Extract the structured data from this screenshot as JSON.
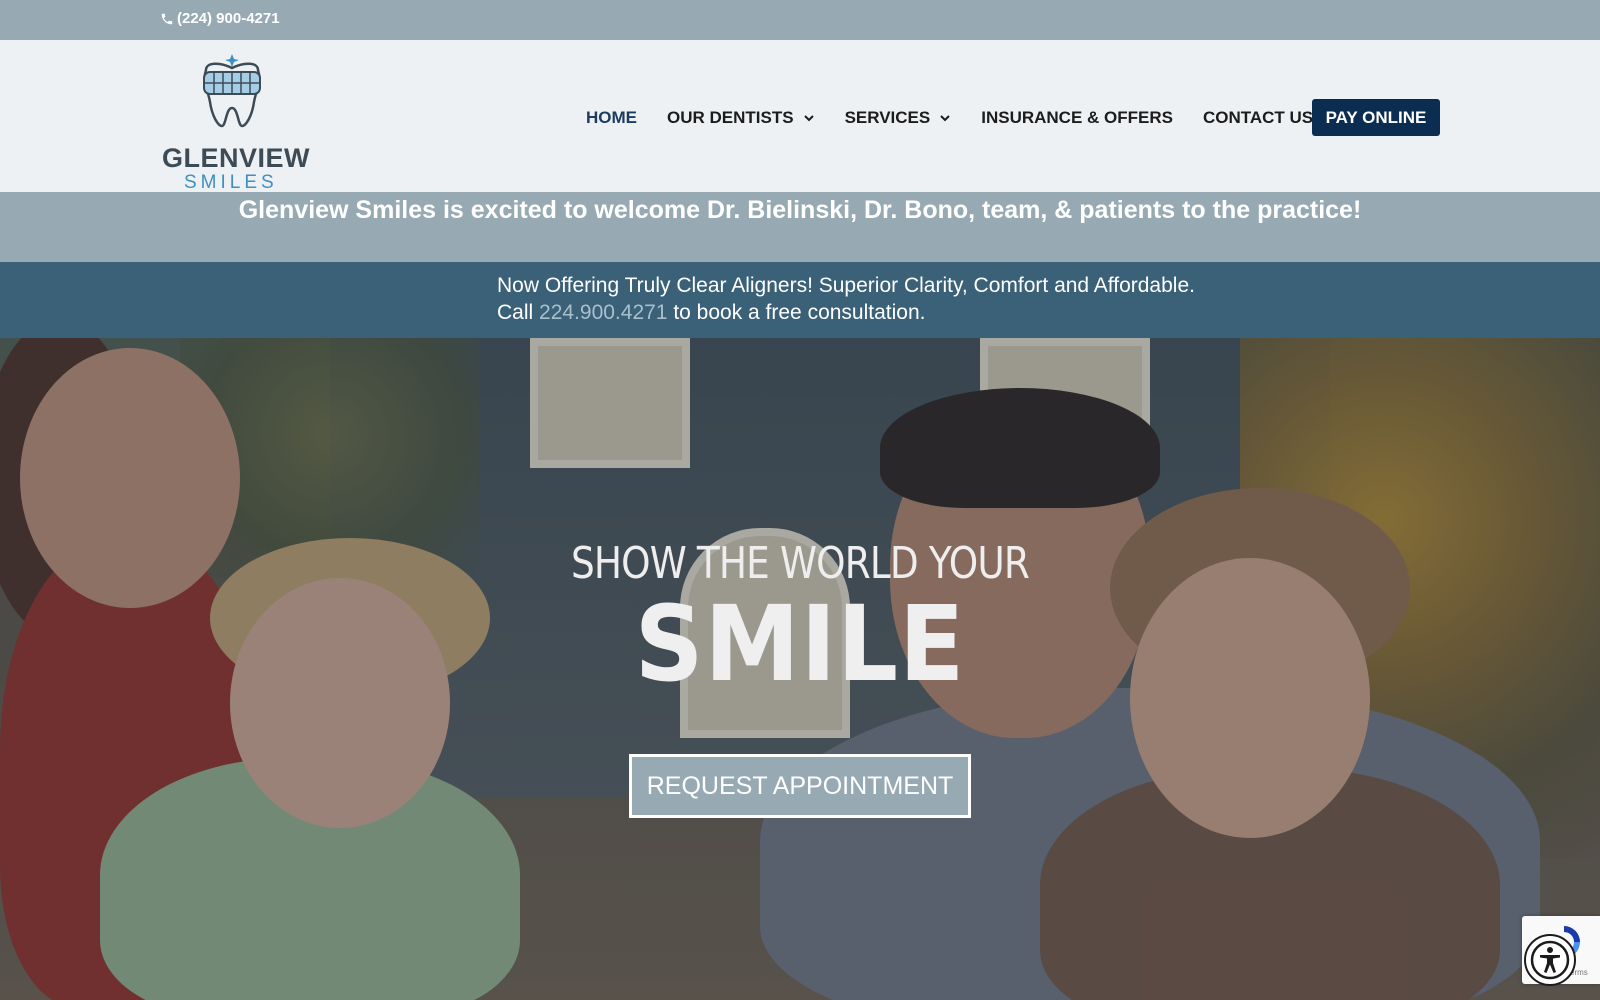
{
  "topbar": {
    "phone": "(224) 900-4271",
    "phone_icon": "phone-icon"
  },
  "logo": {
    "line1": "GLENVIEW",
    "line2": "SMILES",
    "icon": "tooth-logo-icon"
  },
  "nav": {
    "items": [
      {
        "label": "HOME",
        "active": true,
        "dropdown": false
      },
      {
        "label": "OUR DENTISTS",
        "active": false,
        "dropdown": true
      },
      {
        "label": "SERVICES",
        "active": false,
        "dropdown": true
      },
      {
        "label": "INSURANCE & OFFERS",
        "active": false,
        "dropdown": false
      },
      {
        "label": "CONTACT US",
        "active": false,
        "dropdown": false
      }
    ],
    "pay_label": "PAY ONLINE"
  },
  "welcome": {
    "text": "Glenview Smiles is excited to welcome Dr. Bielinski, Dr. Bono, team, & patients to the practice!"
  },
  "offer": {
    "line1": "Now Offering Truly Clear Aligners! Superior Clarity, Comfort and Affordable.",
    "line2_prefix": "Call ",
    "line2_link": "224.900.4271",
    "line2_suffix": " to book a free consultation."
  },
  "hero": {
    "subtitle": "SHOW THE WORLD YOUR",
    "title": "SMILE",
    "button_label": "REQUEST APPOINTMENT"
  },
  "widgets": {
    "recaptcha_terms": "Terms",
    "recaptcha_icon": "recaptcha-icon",
    "accessibility_icon": "accessibility-icon"
  },
  "colors": {
    "topbar_bg": "#97aab4",
    "header_bg": "#eef1f3",
    "nav_active": "#1c3b5e",
    "pay_btn_bg": "#0c2d52",
    "offer_bg": "#3a6178",
    "offer_link": "#a9bfcc",
    "hero_btn_bg": "#97aab4"
  }
}
